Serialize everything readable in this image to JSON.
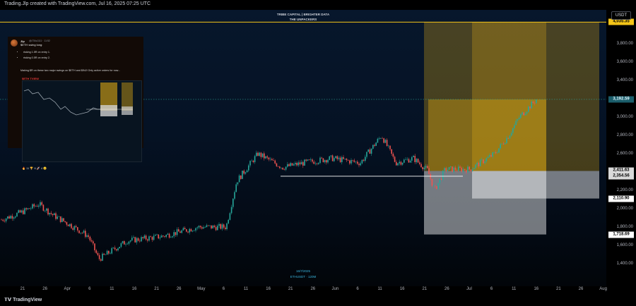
{
  "header": {
    "text": "Trading.Jlp created with TradingView.com, Jul 16, 2025 07:25 UTC"
  },
  "overlay": {
    "title_line1": "TRIBE CAPITAL | BRIGHTER DATA",
    "title_line2": "THE UNPACKERS"
  },
  "currency_badge": "USDT",
  "price_axis": {
    "labels": [
      "3,800.00",
      "3,600.00",
      "3,400.00",
      "3,200.00",
      "3,000.00",
      "2,800.00",
      "2,600.00",
      "2,400.00",
      "2,200.00",
      "2,000.00",
      "1,800.00",
      "1,600.00",
      "1,400.00"
    ],
    "values": [
      3800,
      3600,
      3400,
      3200,
      3000,
      2800,
      2600,
      2400,
      2200,
      2000,
      1800,
      1600,
      1400
    ],
    "tags": [
      {
        "label": "4,035.35",
        "value": 4035.35,
        "bg": "#f5c518",
        "fg": "#000000"
      },
      {
        "label": "3,192.59",
        "value": 3192.59,
        "bg": "#1b5e6b",
        "fg": "#e0f7ff"
      },
      {
        "label": "2,411.63",
        "value": 2411.63,
        "bg": "#d9d9d9",
        "fg": "#000000"
      },
      {
        "label": "2,354.56",
        "value": 2354.56,
        "bg": "#d9d9d9",
        "fg": "#000000"
      },
      {
        "label": "2,110.90",
        "value": 2110.9,
        "bg": "#ffffff",
        "fg": "#000000"
      },
      {
        "label": "1,718.69",
        "value": 1718.69,
        "bg": "#ffffff",
        "fg": "#000000"
      }
    ]
  },
  "time_axis": {
    "labels": [
      "21",
      "26",
      "Apr",
      "6",
      "11",
      "16",
      "21",
      "26",
      "May",
      "6",
      "11",
      "16",
      "21",
      "26",
      "Jun",
      "6",
      "11",
      "16",
      "21",
      "26",
      "Jul",
      "6",
      "11",
      "16",
      "21",
      "26",
      "Aug"
    ]
  },
  "crosshair": {
    "date_label": "16/7/2025",
    "symbol_label": "ETHUSDT · 120M"
  },
  "tweet": {
    "name": "Jlp",
    "handle": "@JTAs1111 · 11:52",
    "headline": "$ETH swing long:",
    "bullets": [
      "risking 1.5R on entry 1.",
      "risking 0.5R on entry 2."
    ],
    "body": "Making $R on these two major swings on $ETH and $INJ! Only active orders for now...",
    "embed_title": "$ETH TVIEW",
    "reactions": "🔥 11   🏆 6   🚀 4   😊"
  },
  "footer": {
    "logo": "TradingView"
  },
  "colors": {
    "bull": "#26a69a",
    "bear": "#ef5350",
    "target_zone": "#f2b612",
    "stop_zone": "#ffffff",
    "current_price_line": "#2a9d8f"
  }
}
